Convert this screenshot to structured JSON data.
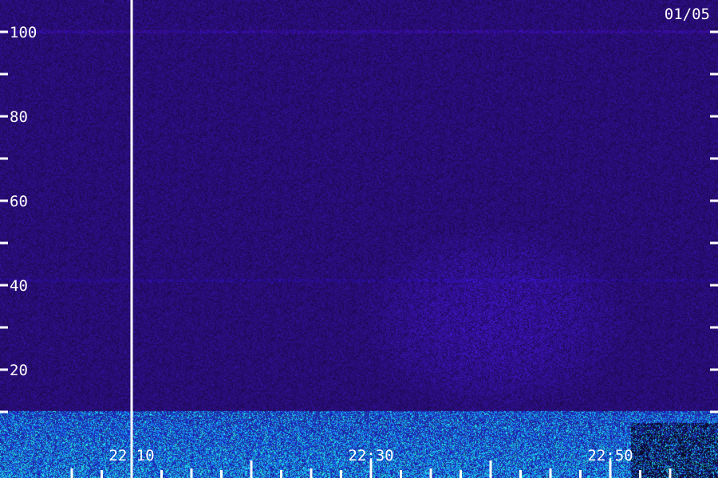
{
  "chart_data": {
    "type": "heatmap",
    "date_label": "01/05",
    "y_axis": {
      "ticks": [
        100,
        80,
        60,
        40,
        20
      ],
      "minor_ticks": [
        90,
        70,
        50,
        30,
        10
      ],
      "range": [
        0,
        110
      ]
    },
    "x_axis": {
      "tick_labels": [
        "22:10",
        "22:30",
        "22:50"
      ],
      "range": [
        "22:07",
        "22:57"
      ]
    },
    "marker_time": "22:10",
    "colors": {
      "background": "#2c0c52",
      "noise_low": "#220a44",
      "noise_high": "#4a20c8",
      "hot": "#20e0c0",
      "hot2": "#30c8ff",
      "axis": "#ffffff"
    }
  }
}
